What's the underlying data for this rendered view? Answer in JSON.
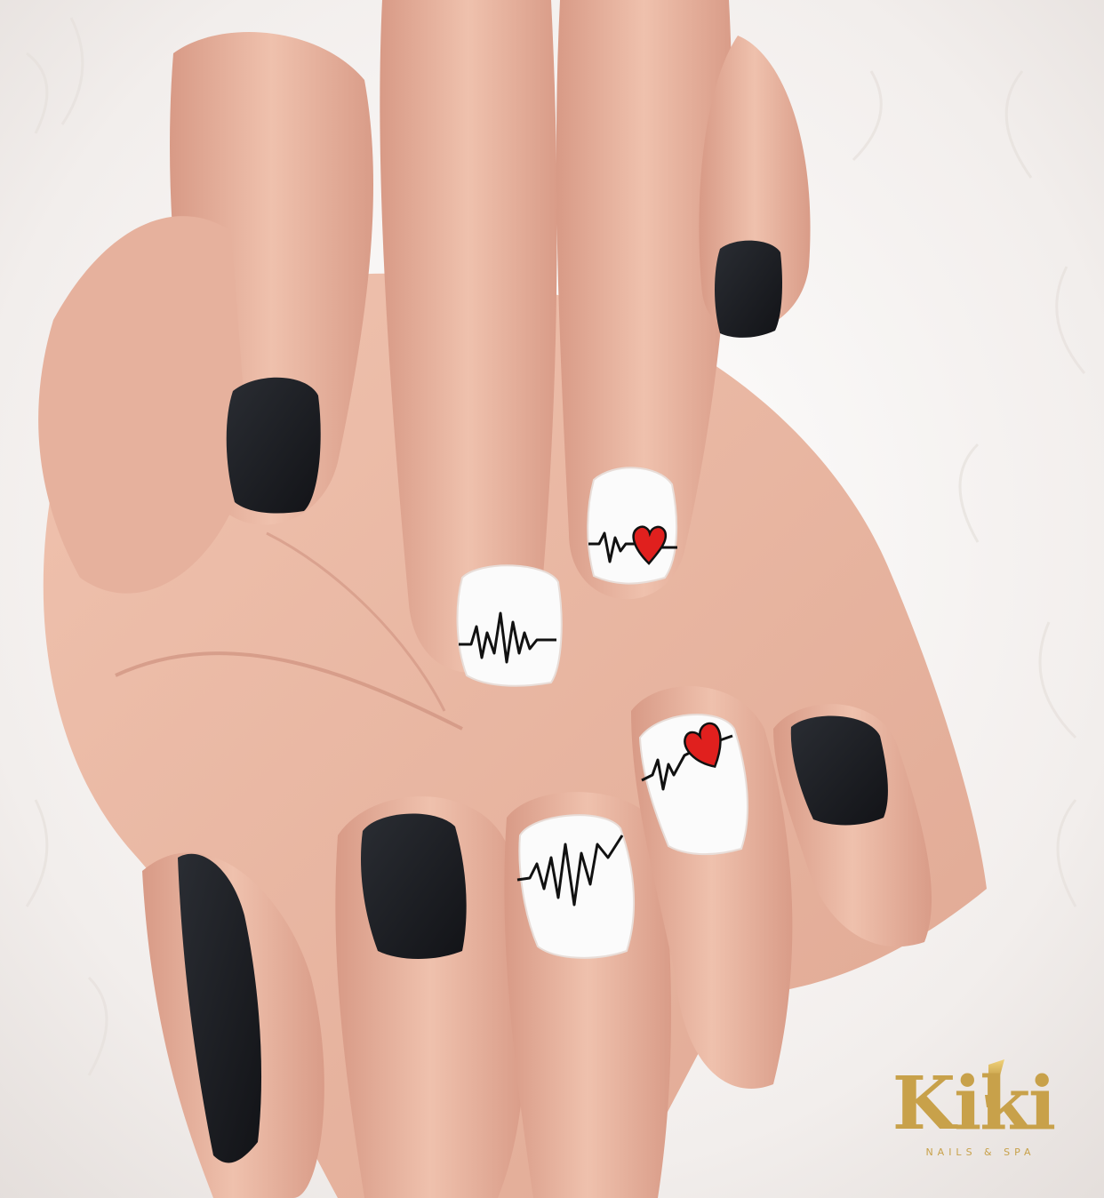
{
  "photo": {
    "subject": "manicure",
    "colors": {
      "fur": "#f4f1ef",
      "skin": "#eab8a3",
      "skin_shadow": "#c98a78",
      "nail_black": "#181a1f",
      "nail_white": "#fbfbfb",
      "ecg_line": "#111111",
      "heart": "#e0201e",
      "logo_gold": "#c8a14a"
    },
    "nails": [
      {
        "finger": "left-upper-index",
        "style": "matte black"
      },
      {
        "finger": "left-upper-middle",
        "style": "white with heartbeat line"
      },
      {
        "finger": "left-upper-ring",
        "style": "white with heartbeat line and red heart"
      },
      {
        "finger": "left-upper-pinky",
        "style": "matte black"
      },
      {
        "finger": "lower-thumb",
        "style": "matte black"
      },
      {
        "finger": "lower-index",
        "style": "matte black"
      },
      {
        "finger": "lower-middle",
        "style": "white with heartbeat line"
      },
      {
        "finger": "lower-ring",
        "style": "white with heartbeat line and red heart"
      },
      {
        "finger": "lower-pinky",
        "style": "matte black"
      }
    ]
  },
  "watermark": {
    "brand": "Kiki",
    "tagline": "NAILS & SPA",
    "icon": "nail-polish-brush-icon"
  }
}
